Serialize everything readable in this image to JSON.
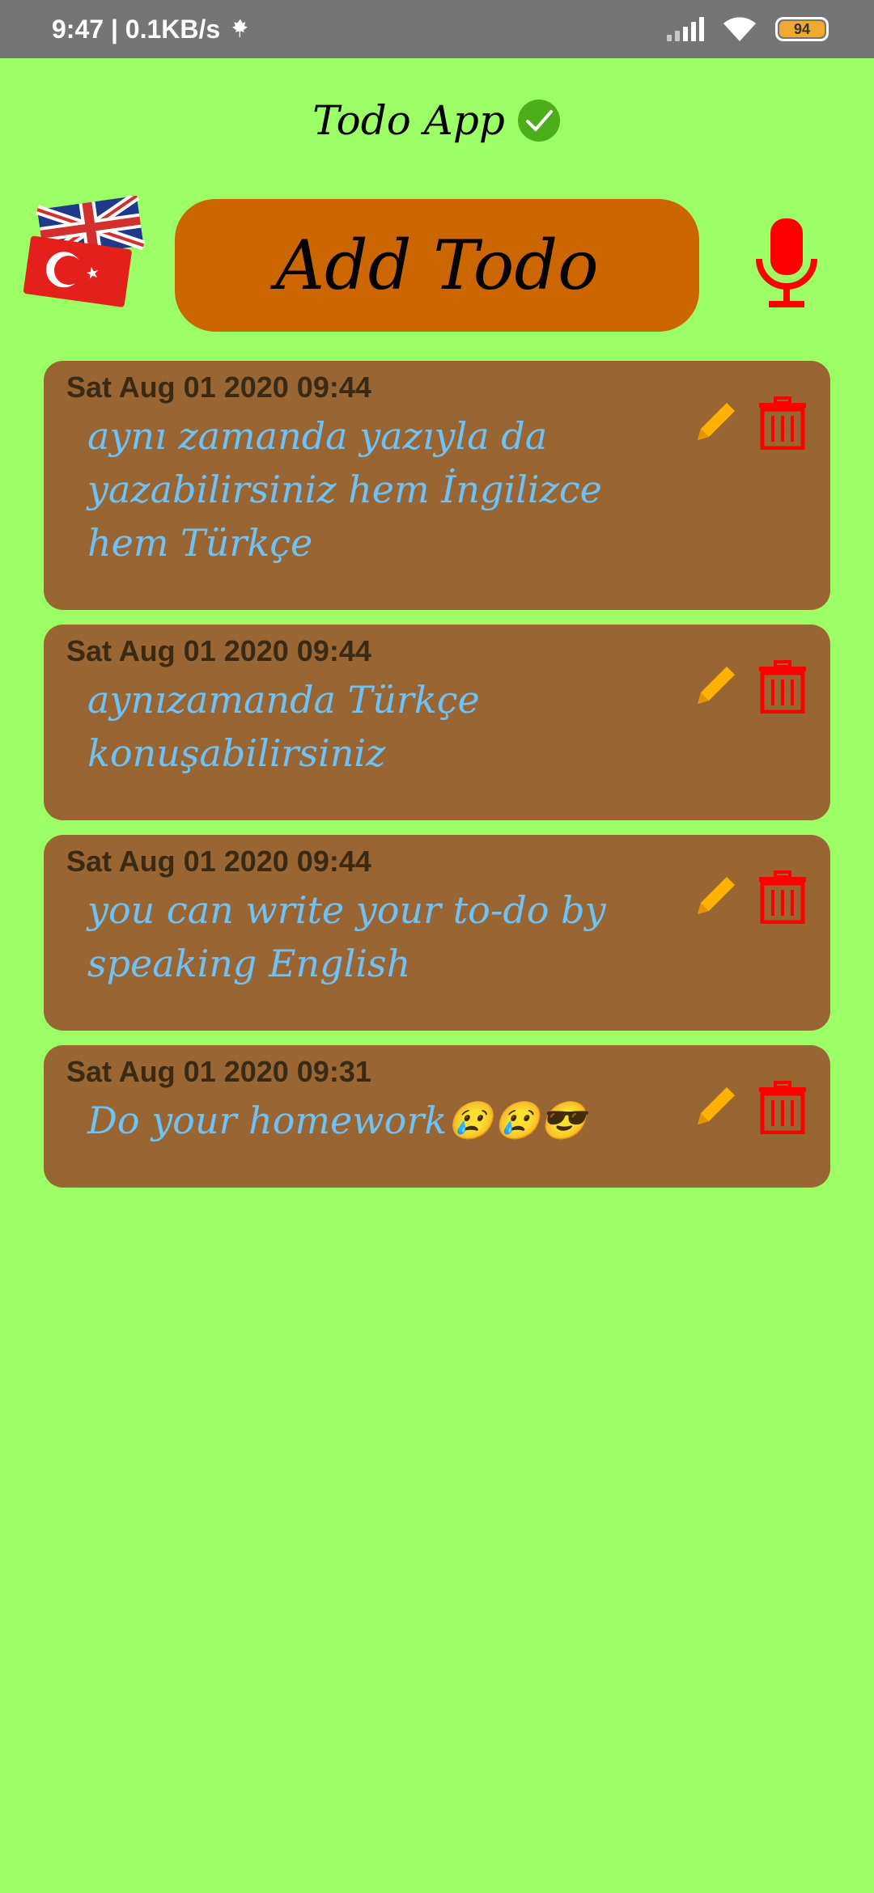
{
  "status_bar": {
    "time_speed": "9:47 | 0.1KB/s",
    "leaf_icon": "maple-leaf-icon",
    "battery": "94"
  },
  "header": {
    "title": "Todo App",
    "title_icon": "check-icon"
  },
  "actions": {
    "add_label": "Add Todo",
    "language_icon": "uk-turkey-flag-icon",
    "mic_icon": "microphone-icon"
  },
  "colors": {
    "background": "#9cff66",
    "add_button": "#cc6600",
    "card": "#996633",
    "todo_text": "#6fc2f5",
    "edit": "#ffb300",
    "delete": "#ff0000"
  },
  "todos": [
    {
      "date": "Sat Aug 01 2020 09:44",
      "text": "aynı zamanda yazıyla da yazabilirsiniz hem İngilizce hem Türkçe"
    },
    {
      "date": "Sat Aug 01 2020 09:44",
      "text": "aynızamanda Türkçe konuşabilirsiniz"
    },
    {
      "date": "Sat Aug 01 2020 09:44",
      "text": "you can write your to-do by speaking English"
    },
    {
      "date": "Sat Aug 01 2020 09:31",
      "text": "Do your homework😢😢😎"
    }
  ]
}
